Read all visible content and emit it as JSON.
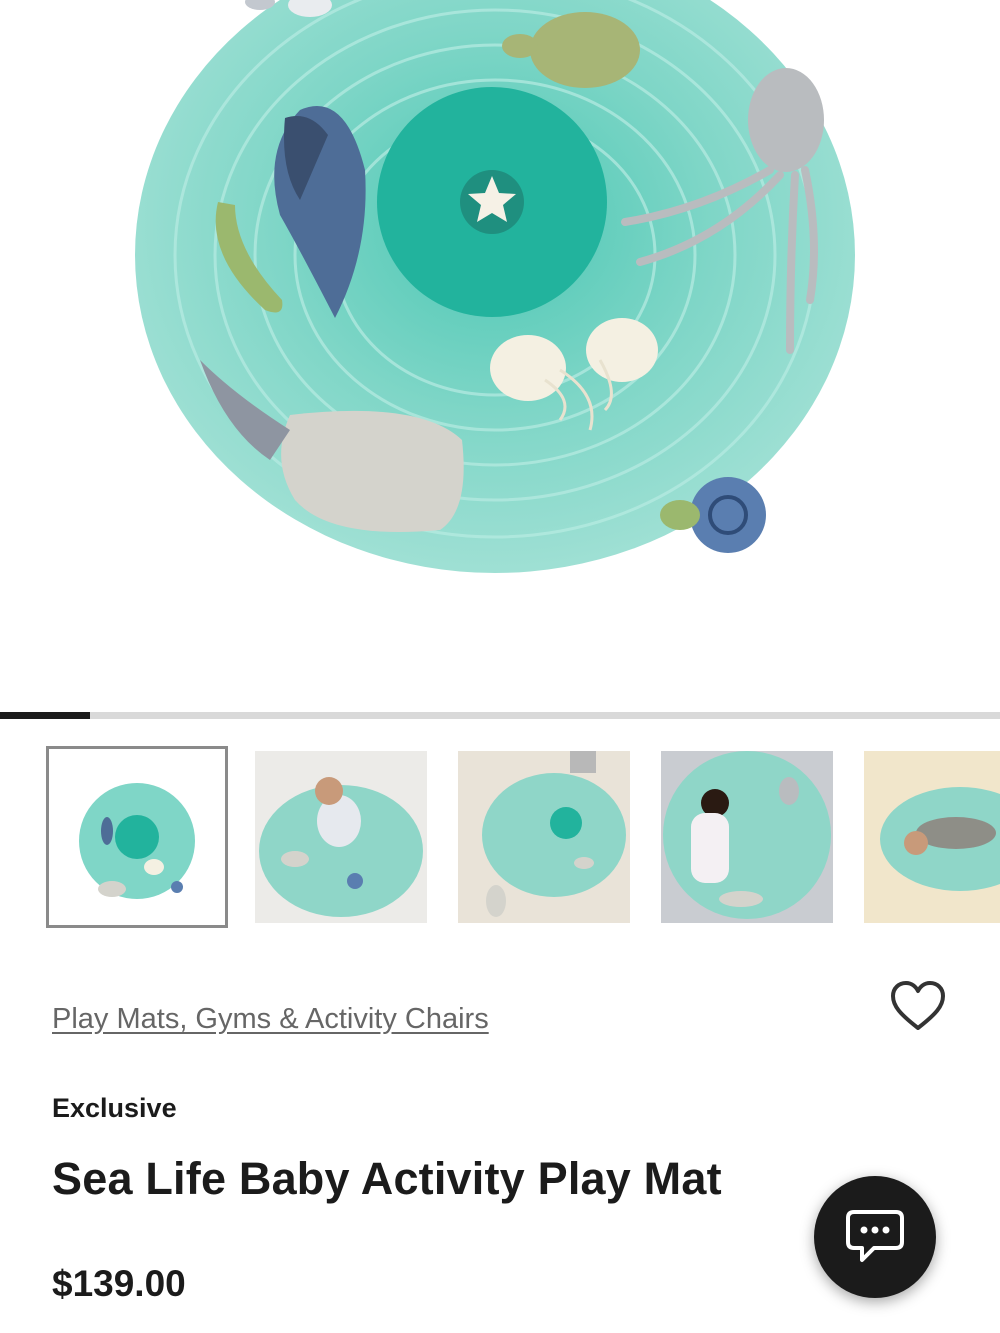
{
  "product": {
    "category_link": "Play Mats, Gyms & Activity Chairs",
    "badge": "Exclusive",
    "title": "Sea Life Baby Activity Play Mat",
    "price": "$139.00"
  },
  "gallery": {
    "thumbnail_count_visible": 5,
    "selected_index": 0,
    "progress": 0.09
  },
  "icons": {
    "wishlist": "heart-outline-icon",
    "chat": "chat-bubble-icon"
  },
  "colors": {
    "text": "#1b1b1b",
    "link": "#666666",
    "mat_teal": "#7fd6c7",
    "progress_track": "#d9d9d9"
  }
}
